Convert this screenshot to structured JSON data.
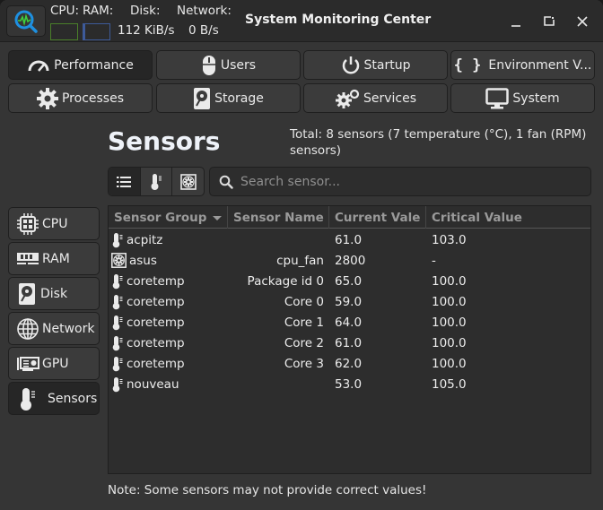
{
  "header": {
    "title": "System Monitoring Center",
    "app_icon": "app-monitor-icon",
    "cpu_label": "CPU:",
    "ram_label": "RAM:",
    "disk_label": "Disk:",
    "network_label": "Network:",
    "cpu_usage_fraction": 0.0,
    "ram_usage_fraction": 0.08,
    "disk_speed": "112 KiB/s",
    "network_speed": "0 B/s",
    "colors": {
      "cpu_bar": "#4a7f2a",
      "ram_bar": "#3d5a99"
    },
    "window_controls": {
      "minimize": "minimize-icon",
      "restore": "restore-icon",
      "close": "close-icon"
    }
  },
  "tabs": [
    {
      "label": "Performance",
      "icon": "gauge-icon",
      "active": true
    },
    {
      "label": "Users",
      "icon": "mouse-icon",
      "active": false
    },
    {
      "label": "Startup",
      "icon": "power-icon",
      "active": false
    },
    {
      "label": "Environment V...",
      "icon": "braces-icon",
      "active": false
    },
    {
      "label": "Processes",
      "icon": "gear-icon",
      "active": false
    },
    {
      "label": "Storage",
      "icon": "hard-disk-icon",
      "active": false
    },
    {
      "label": "Services",
      "icon": "gears-icon",
      "active": false
    },
    {
      "label": "System",
      "icon": "monitor-icon",
      "active": false
    }
  ],
  "sidebar": {
    "items": [
      {
        "label": "CPU",
        "icon": "cpu-icon",
        "active": false
      },
      {
        "label": "RAM",
        "icon": "ram-icon",
        "active": false
      },
      {
        "label": "Disk",
        "icon": "hard-disk-icon",
        "active": false
      },
      {
        "label": "Network",
        "icon": "globe-icon",
        "active": false
      },
      {
        "label": "GPU",
        "icon": "gpu-icon",
        "active": false
      },
      {
        "label": "Sensors",
        "icon": "thermometer-icon",
        "active": true
      }
    ]
  },
  "main": {
    "title": "Sensors",
    "summary": "Total: 8 sensors (7 temperature (°C), 1 fan (RPM) sensors)",
    "filters": [
      {
        "name": "all",
        "icon": "list-icon",
        "active": true
      },
      {
        "name": "temperature",
        "icon": "thermometer-icon",
        "active": false
      },
      {
        "name": "fan",
        "icon": "fan-icon",
        "active": false
      }
    ],
    "search": {
      "placeholder": "Search sensor...",
      "value": ""
    },
    "table": {
      "columns": [
        "Sensor Group",
        "Sensor Name",
        "Current Vale",
        "Critical Value"
      ],
      "sort_column": "Sensor Group",
      "sort_direction": "descending",
      "rows": [
        {
          "type": "temperature",
          "group": "acpitz",
          "name": "",
          "current": "61.0",
          "critical": "103.0"
        },
        {
          "type": "fan",
          "group": "asus",
          "name": "cpu_fan",
          "current": "2800",
          "critical": "-"
        },
        {
          "type": "temperature",
          "group": "coretemp",
          "name": "Package id 0",
          "current": "65.0",
          "critical": "100.0"
        },
        {
          "type": "temperature",
          "group": "coretemp",
          "name": "Core 0",
          "current": "59.0",
          "critical": "100.0"
        },
        {
          "type": "temperature",
          "group": "coretemp",
          "name": "Core 1",
          "current": "64.0",
          "critical": "100.0"
        },
        {
          "type": "temperature",
          "group": "coretemp",
          "name": "Core 2",
          "current": "61.0",
          "critical": "100.0"
        },
        {
          "type": "temperature",
          "group": "coretemp",
          "name": "Core 3",
          "current": "62.0",
          "critical": "100.0"
        },
        {
          "type": "temperature",
          "group": "nouveau",
          "name": "",
          "current": "53.0",
          "critical": "105.0"
        }
      ]
    },
    "note": "Note: Some sensors may not provide correct values!"
  }
}
